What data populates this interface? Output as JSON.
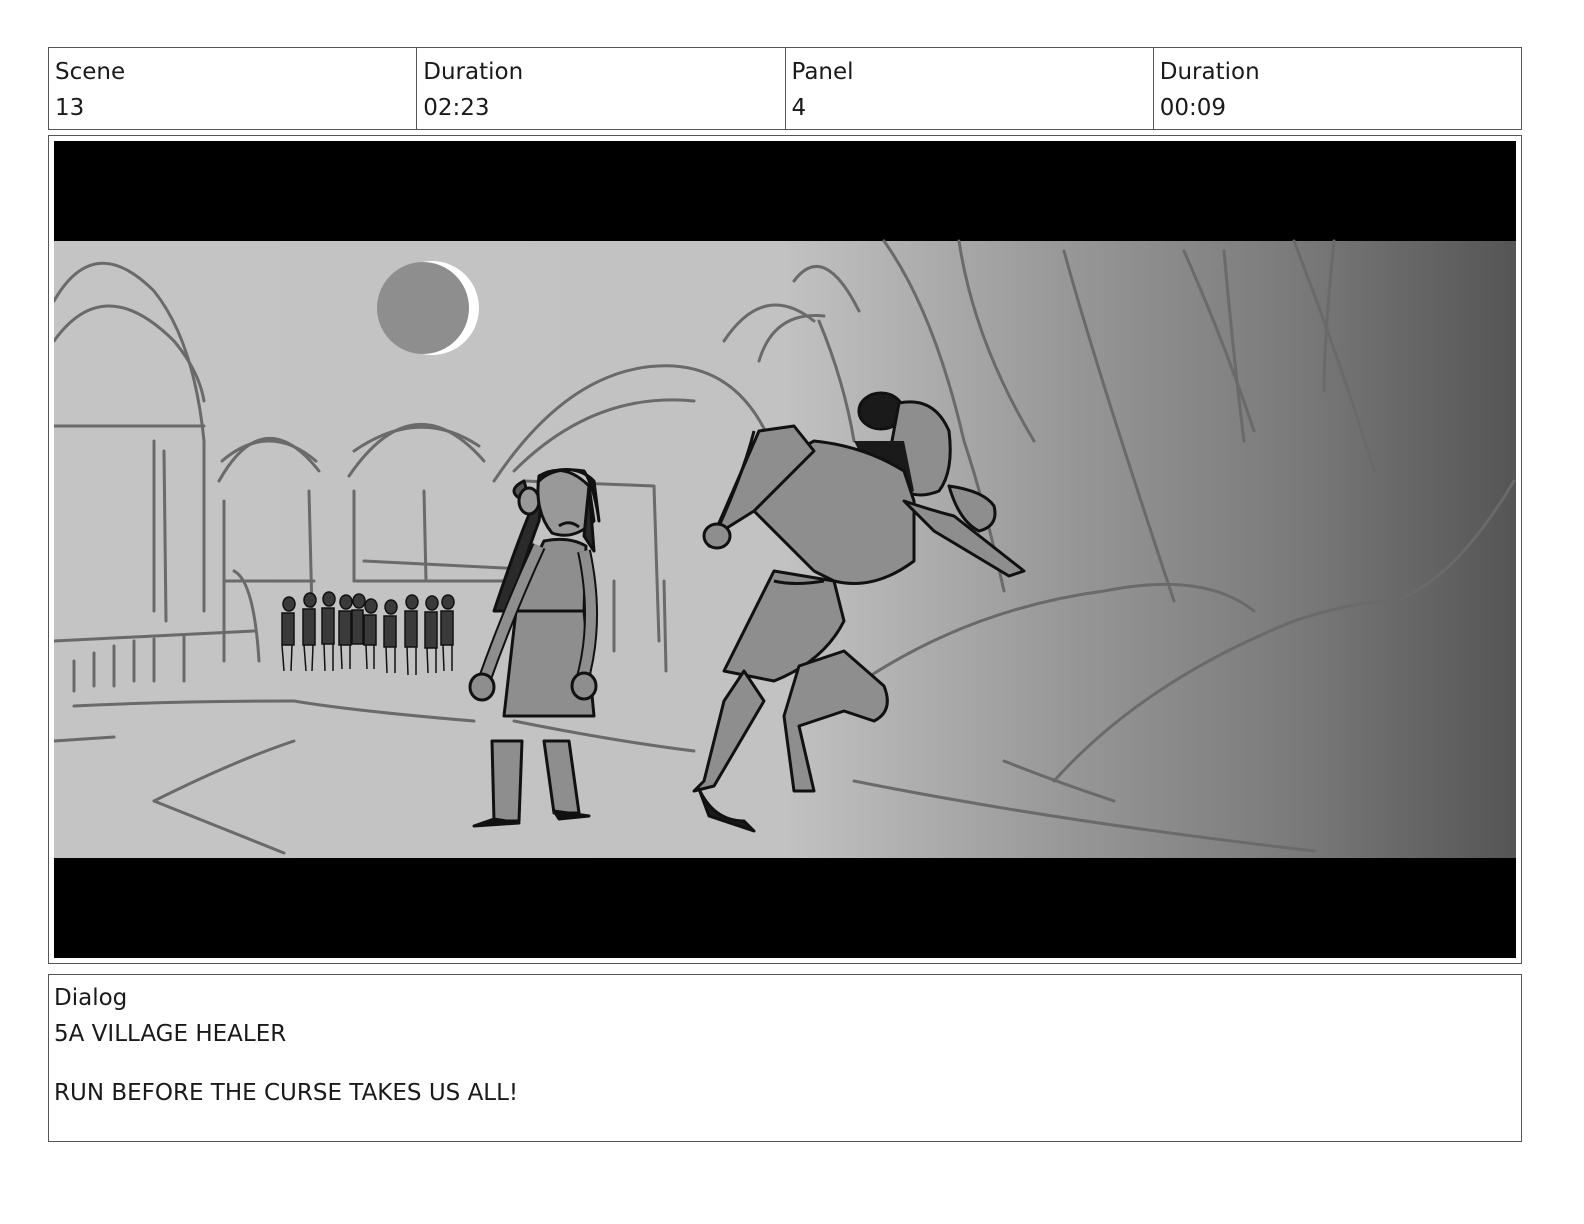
{
  "header": {
    "cells": [
      {
        "label": "Scene",
        "value": "13"
      },
      {
        "label": "Duration",
        "value": "02:23"
      },
      {
        "label": "Panel",
        "value": "4"
      },
      {
        "label": "Duration",
        "value": "00:09"
      }
    ]
  },
  "dialog": {
    "label": "Dialog",
    "speaker": "5A VILLAGE HEALER",
    "line": "RUN BEFORE THE CURSE TAKES US ALL!"
  }
}
